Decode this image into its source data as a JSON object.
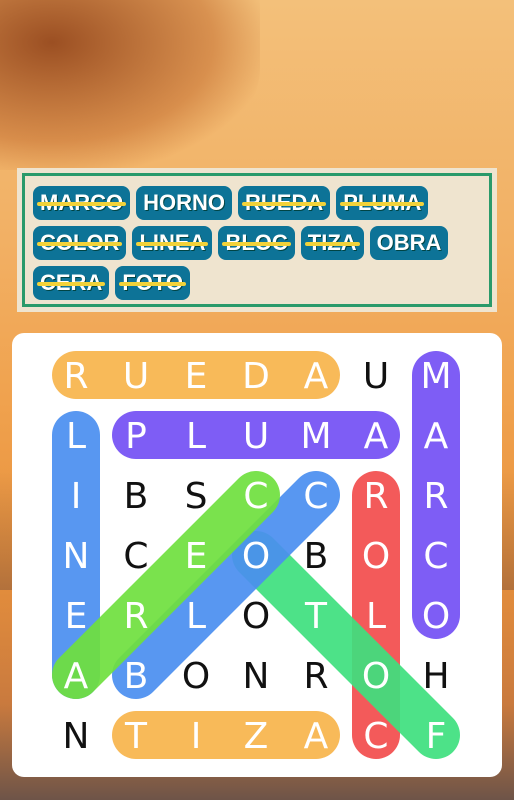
{
  "words": [
    {
      "text": "MARCO",
      "found": true
    },
    {
      "text": "HORNO",
      "found": false
    },
    {
      "text": "RUEDA",
      "found": true
    },
    {
      "text": "PLUMA",
      "found": true
    },
    {
      "text": "COLOR",
      "found": true
    },
    {
      "text": "LINEA",
      "found": true
    },
    {
      "text": "BLOC",
      "found": true
    },
    {
      "text": "TIZA",
      "found": true
    },
    {
      "text": "OBRA",
      "found": false
    },
    {
      "text": "CERA",
      "found": true
    },
    {
      "text": "FOTO",
      "found": true
    }
  ],
  "grid": [
    [
      "R",
      "U",
      "E",
      "D",
      "A",
      "U",
      "M"
    ],
    [
      "L",
      "P",
      "L",
      "U",
      "M",
      "A",
      "A"
    ],
    [
      "I",
      "B",
      "S",
      "C",
      "C",
      "R",
      "R"
    ],
    [
      "N",
      "C",
      "E",
      "O",
      "B",
      "O",
      "C"
    ],
    [
      "E",
      "R",
      "L",
      "O",
      "T",
      "L",
      "O"
    ],
    [
      "A",
      "B",
      "O",
      "N",
      "R",
      "O",
      "H"
    ],
    [
      "N",
      "T",
      "I",
      "Z",
      "A",
      "C",
      "F"
    ]
  ],
  "highlights": [
    {
      "word": "RUEDA",
      "from": [
        0,
        0
      ],
      "to": [
        0,
        4
      ],
      "color": "#f8b54c"
    },
    {
      "word": "TIZA",
      "from": [
        6,
        1
      ],
      "to": [
        6,
        4
      ],
      "color": "#f8b54c"
    },
    {
      "word": "PLUMA",
      "from": [
        1,
        1
      ],
      "to": [
        1,
        5
      ],
      "color": "#7450f5"
    },
    {
      "word": "MARCO",
      "from": [
        0,
        6
      ],
      "to": [
        4,
        6
      ],
      "color": "#7450f5"
    },
    {
      "word": "LINEA",
      "from": [
        1,
        0
      ],
      "to": [
        5,
        0
      ],
      "color": "#4a8ff0"
    },
    {
      "word": "COLOR",
      "from": [
        6,
        5
      ],
      "to": [
        2,
        5
      ],
      "color": "#f24d4d"
    },
    {
      "word": "FOTO",
      "from": [
        6,
        6
      ],
      "to": [
        3,
        3
      ],
      "color": "#3ee07e"
    },
    {
      "word": "BLOC",
      "from": [
        5,
        1
      ],
      "to": [
        2,
        4
      ],
      "color": "#4a8ff0"
    },
    {
      "word": "CERA",
      "from": [
        2,
        3
      ],
      "to": [
        5,
        0
      ],
      "color": "#6fe03e"
    }
  ]
}
